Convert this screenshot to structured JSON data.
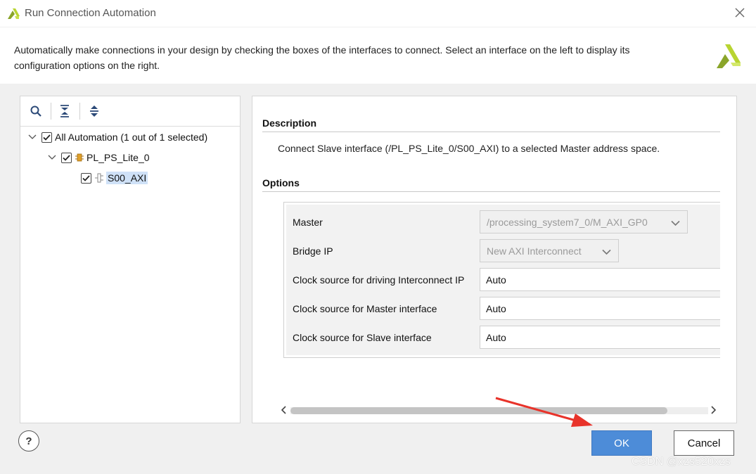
{
  "window": {
    "title": "Run Connection Automation",
    "close_icon": "close-icon",
    "logo_icon": "xilinx-logo-icon"
  },
  "header": {
    "text": "Automatically make connections in your design by checking the boxes of the interfaces to connect. Select an interface on the left to display its configuration options on the right."
  },
  "toolbar": {
    "search_icon": "search-icon",
    "collapse_icon": "collapse-all-icon",
    "expand_icon": "expand-all-icon"
  },
  "tree": {
    "root": {
      "label": "All Automation (1 out of 1 selected)",
      "checked": true,
      "expanded": true
    },
    "ip": {
      "label": "PL_PS_Lite_0",
      "checked": true,
      "expanded": true,
      "icon": "ip-block-icon"
    },
    "interface": {
      "label": "S00_AXI",
      "checked": true,
      "selected": true,
      "icon": "bus-interface-icon"
    }
  },
  "description": {
    "heading": "Description",
    "text": "Connect Slave interface (/PL_PS_Lite_0/S00_AXI) to a selected Master address space."
  },
  "options": {
    "heading": "Options",
    "master": {
      "label": "Master",
      "value": "/processing_system7_0/M_AXI_GP0"
    },
    "bridge": {
      "label": "Bridge IP",
      "value": "New AXI Interconnect"
    },
    "clk_interconnect": {
      "label": "Clock source for driving Interconnect IP",
      "value": "Auto"
    },
    "clk_master": {
      "label": "Clock source for Master interface",
      "value": "Auto"
    },
    "clk_slave": {
      "label": "Clock source for Slave interface",
      "value": "Auto"
    }
  },
  "footer": {
    "help_label": "?",
    "ok_label": "OK",
    "cancel_label": "Cancel"
  },
  "watermark": "CSDN @xzs520xzs",
  "colors": {
    "ok_button": "#4d8cd8",
    "selection": "#cfe1f7",
    "annotation_arrow": "#e8332a",
    "logo_light": "#b8d432",
    "logo_dark": "#8aa52a"
  }
}
